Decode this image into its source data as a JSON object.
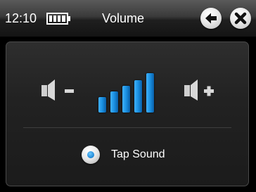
{
  "status": {
    "time": "12:10",
    "battery_icon": "battery-full-icon",
    "battery_level": 1.0
  },
  "header": {
    "title": "Volume",
    "back_icon": "back-arrow-icon",
    "close_icon": "close-x-icon"
  },
  "volume": {
    "down_icon": "speaker-minus-icon",
    "up_icon": "speaker-plus-icon",
    "level_bars_total": 5,
    "level_bars_filled": 5,
    "bar_color": "#1a8fe0"
  },
  "options": {
    "tap_sound": {
      "label": "Tap Sound",
      "selected": true
    }
  }
}
